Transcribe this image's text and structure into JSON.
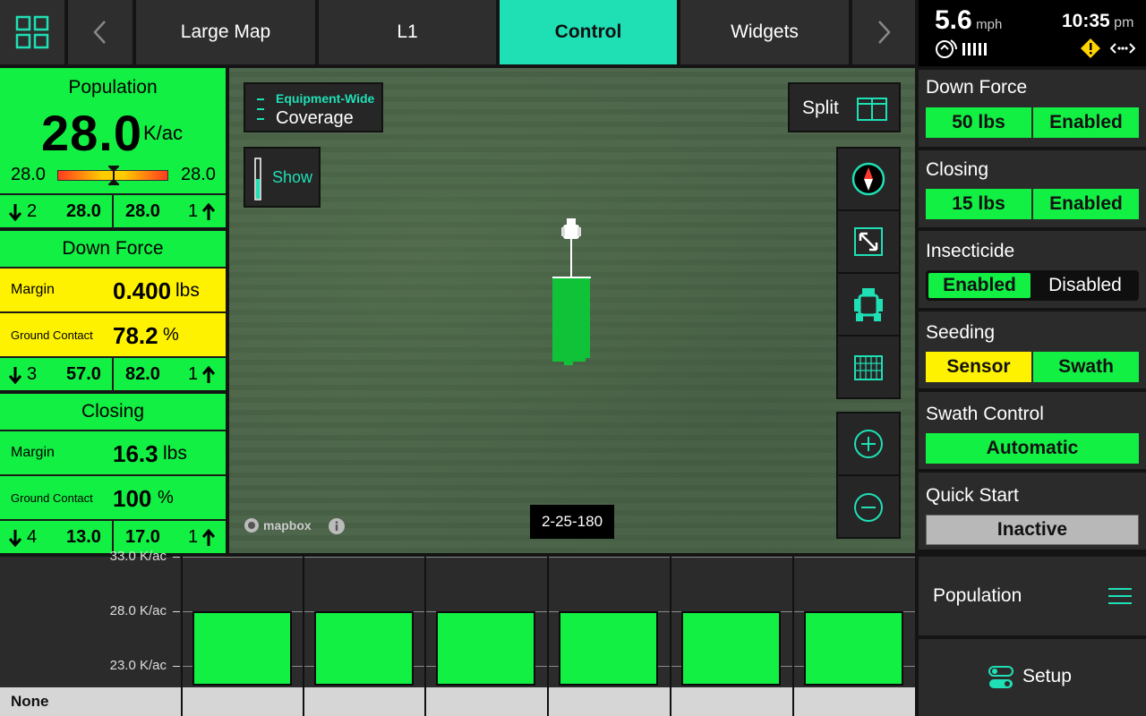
{
  "nav": {
    "tabs": [
      {
        "label": "Large Map"
      },
      {
        "label": "L1"
      },
      {
        "label": "Control"
      },
      {
        "label": "Widgets"
      }
    ],
    "active_tab": "Control"
  },
  "status": {
    "speed": "5.6",
    "speed_unit": "mph",
    "time": "10:35",
    "ampm": "pm"
  },
  "population": {
    "title": "Population",
    "value": "28.0",
    "unit": "K/ac",
    "range_min": "28.0",
    "range_max": "28.0",
    "gauge_fraction": 0.5,
    "left_count": "2",
    "left_value": "28.0",
    "right_value": "28.0",
    "right_count": "1"
  },
  "downforce_left": {
    "title": "Down Force",
    "margin_label": "Margin",
    "margin_value": "0.400",
    "margin_unit": "lbs",
    "gc_label": "Ground Contact",
    "gc_value": "78.2",
    "gc_unit": "%",
    "left_count": "3",
    "left_value": "57.0",
    "right_value": "82.0",
    "right_count": "1"
  },
  "closing_left": {
    "title": "Closing",
    "margin_label": "Margin",
    "margin_value": "16.3",
    "margin_unit": "lbs",
    "gc_label": "Ground Contact",
    "gc_value": "100",
    "gc_unit": "%",
    "left_count": "4",
    "left_value": "13.0",
    "right_value": "17.0",
    "right_count": "1"
  },
  "map": {
    "equip_label": "Equipment-Wide",
    "coverage_label": "Coverage",
    "show_label": "Show",
    "split_label": "Split",
    "mapbox_label": "mapbox",
    "location_code": "2-25-180"
  },
  "right_panel": {
    "downforce": {
      "title": "Down Force",
      "left": "50 lbs",
      "right": "Enabled"
    },
    "closing": {
      "title": "Closing",
      "left": "15 lbs",
      "right": "Enabled"
    },
    "insecticide": {
      "title": "Insecticide",
      "left": "Enabled",
      "right": "Disabled"
    },
    "seeding": {
      "title": "Seeding",
      "left": "Sensor",
      "right": "Swath"
    },
    "swath": {
      "title": "Swath Control",
      "value": "Automatic"
    },
    "quickstart": {
      "title": "Quick Start",
      "value": "Inactive"
    },
    "population_menu": "Population",
    "setup": "Setup"
  },
  "chart_data": {
    "type": "bar",
    "categories": [
      "",
      "",
      "",
      "",
      "",
      ""
    ],
    "values": [
      28.0,
      28.0,
      28.0,
      28.0,
      28.0,
      28.0
    ],
    "ylim": [
      21.0,
      33.0
    ],
    "ticks": [
      {
        "value": 33.0,
        "label": "33.0 K/ac"
      },
      {
        "value": 28.0,
        "label": "28.0 K/ac"
      },
      {
        "value": 23.0,
        "label": "23.0 K/ac"
      }
    ],
    "grid": true
  },
  "chart_footer": "None",
  "colors": {
    "accent": "#1fe0b5",
    "green": "#12f044",
    "yellow": "#fff200"
  }
}
